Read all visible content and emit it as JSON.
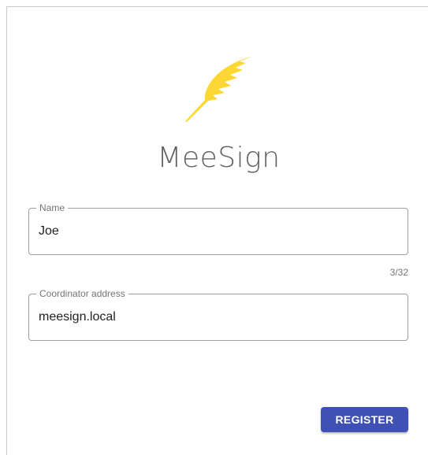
{
  "app": {
    "title": "MeeSign",
    "logo_icon": "feather-icon",
    "logo_color": "#FDD835"
  },
  "form": {
    "name": {
      "label": "Name",
      "value": "Joe",
      "counter": "3/32"
    },
    "coordinator": {
      "label": "Coordinator address",
      "value": "meesign.local"
    }
  },
  "actions": {
    "register_label": "REGISTER",
    "register_color": "#3F51B5"
  }
}
